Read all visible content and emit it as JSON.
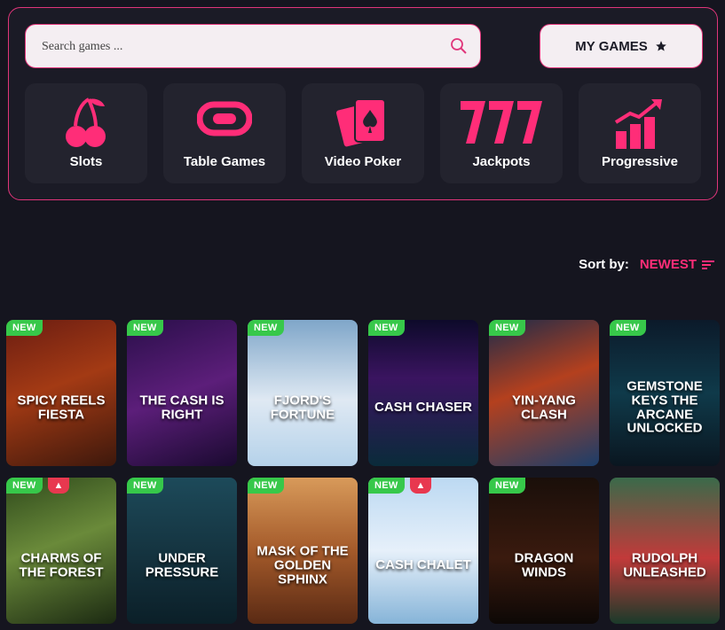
{
  "search": {
    "placeholder": "Search games ..."
  },
  "my_games": {
    "label": "MY GAMES",
    "icon": "star-icon"
  },
  "categories": [
    {
      "label": "Slots",
      "icon": "cherries-icon"
    },
    {
      "label": "Table Games",
      "icon": "table-icon"
    },
    {
      "label": "Video Poker",
      "icon": "playing-cards-icon"
    },
    {
      "label": "Jackpots",
      "icon": "sevens-icon"
    },
    {
      "label": "Progressive",
      "icon": "rising-bars-icon"
    }
  ],
  "sort": {
    "label": "Sort by:",
    "value": "NEWEST"
  },
  "badges": {
    "new": "NEW"
  },
  "colors": {
    "accent": "#e0357a",
    "new_badge": "#37c84a",
    "hot_badge": "#e8384f"
  },
  "games": [
    {
      "title": "SPICY REELS FIESTA",
      "new": true,
      "hot": false
    },
    {
      "title": "THE CASH IS RIGHT",
      "new": true,
      "hot": false
    },
    {
      "title": "FJORD'S FORTUNE",
      "new": true,
      "hot": false
    },
    {
      "title": "CASH CHASER",
      "new": true,
      "hot": false
    },
    {
      "title": "YIN-YANG CLASH",
      "new": true,
      "hot": false
    },
    {
      "title": "GEMSTONE KEYS THE ARCANE UNLOCKED",
      "new": true,
      "hot": false
    },
    {
      "title": "CHARMS OF THE FOREST",
      "new": true,
      "hot": true
    },
    {
      "title": "UNDER PRESSURE",
      "new": true,
      "hot": false
    },
    {
      "title": "MASK OF THE GOLDEN SPHINX",
      "new": true,
      "hot": false
    },
    {
      "title": "CASH CHALET",
      "new": true,
      "hot": true
    },
    {
      "title": "DRAGON WINDS",
      "new": true,
      "hot": false
    },
    {
      "title": "RUDOLPH UNLEASHED",
      "new": false,
      "hot": false
    }
  ]
}
